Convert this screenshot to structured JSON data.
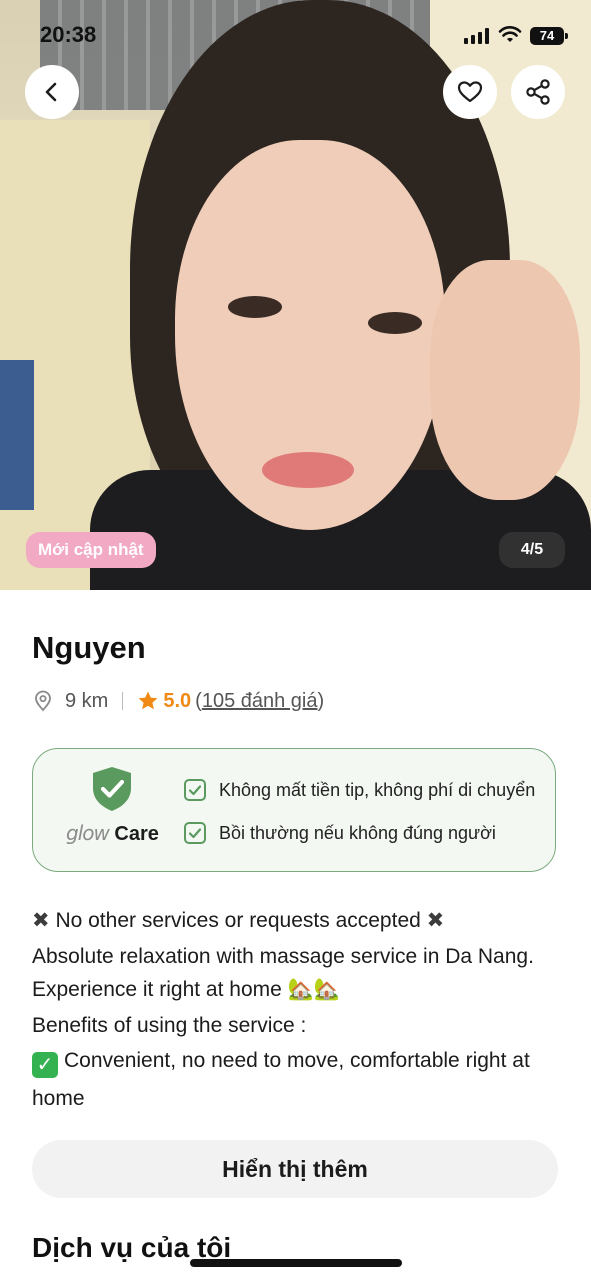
{
  "status_bar": {
    "time": "20:38",
    "battery": "74"
  },
  "hero": {
    "badge": "Mới cập nhật",
    "photo_counter": "4/5",
    "back_icon": "chevron-left-icon",
    "favorite_icon": "heart-icon",
    "share_icon": "share-icon"
  },
  "profile": {
    "name": "Nguyen",
    "distance": "9 km",
    "rating": "5.0",
    "reviews_open": "(",
    "reviews": "105 đánh giá",
    "reviews_close": ")"
  },
  "glow_care": {
    "brand_glow": "glow",
    "brand_care": "Care",
    "features": [
      "Không mất tiền tip, không phí di chuyển",
      "Bồi thường nếu không đúng người"
    ]
  },
  "description": {
    "line1": "No other services or requests accepted",
    "line2": "Absolute relaxation with massage service in Da Nang. Experience it right at home",
    "line3": "Benefits of using the service :",
    "line4": "Convenient, no need to move, comfortable right at home"
  },
  "buttons": {
    "show_more": "Hiển thị thêm"
  },
  "sections": {
    "my_services": "Dịch vụ của tôi"
  },
  "colors": {
    "accent_orange": "#f08a14",
    "care_green": "#5a9a5e",
    "badge_pink": "#f2a9c4"
  }
}
